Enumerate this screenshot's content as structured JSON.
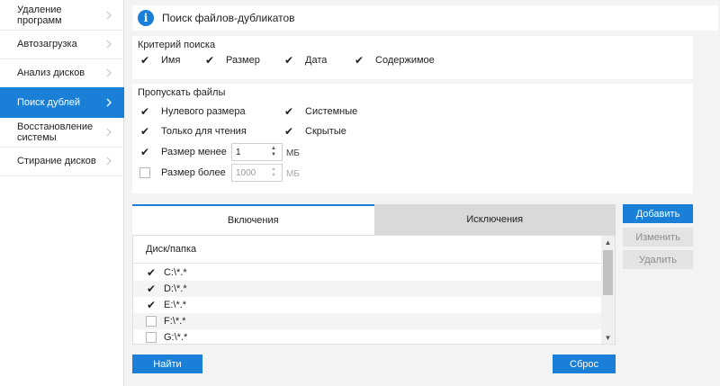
{
  "sidebar": {
    "items": [
      {
        "label": "Удаление программ",
        "active": false
      },
      {
        "label": "Автозагрузка",
        "active": false
      },
      {
        "label": "Анализ дисков",
        "active": false
      },
      {
        "label": "Поиск дублей",
        "active": true
      },
      {
        "label": "Восстановление системы",
        "active": false
      },
      {
        "label": "Стирание дисков",
        "active": false
      }
    ]
  },
  "header": {
    "icon": "info-icon",
    "title": "Поиск файлов-дубликатов"
  },
  "criteria": {
    "title": "Критерий поиска",
    "options": [
      {
        "label": "Имя",
        "checked": true
      },
      {
        "label": "Размер",
        "checked": true
      },
      {
        "label": "Дата",
        "checked": true
      },
      {
        "label": "Содержимое",
        "checked": true
      }
    ]
  },
  "skip": {
    "title": "Пропускать файлы",
    "zero_size": {
      "label": "Нулевого размера",
      "checked": true
    },
    "system": {
      "label": "Системные",
      "checked": true
    },
    "read_only": {
      "label": "Только для чтения",
      "checked": true
    },
    "hidden": {
      "label": "Скрытые",
      "checked": true
    },
    "size_less": {
      "label": "Размер менее",
      "checked": true,
      "value": "1",
      "unit": "МБ"
    },
    "size_more": {
      "label": "Размер более",
      "checked": false,
      "value": "1000",
      "unit": "МБ"
    }
  },
  "tabs": {
    "include": "Включения",
    "exclude": "Исключения"
  },
  "list": {
    "column_header": "Диск/папка",
    "rows": [
      {
        "path": "C:\\*.*",
        "checked": true
      },
      {
        "path": "D:\\*.*",
        "checked": true
      },
      {
        "path": "E:\\*.*",
        "checked": true
      },
      {
        "path": "F:\\*.*",
        "checked": false
      },
      {
        "path": "G:\\*.*",
        "checked": false
      }
    ]
  },
  "actions": {
    "add": "Добавить",
    "edit": "Изменить",
    "delete": "Удалить"
  },
  "footer": {
    "find": "Найти",
    "reset": "Сброс"
  },
  "colors": {
    "accent": "#1a7fd6",
    "disabled_button": "#e3e3e3",
    "inactive_tab": "#d9d9d9"
  }
}
